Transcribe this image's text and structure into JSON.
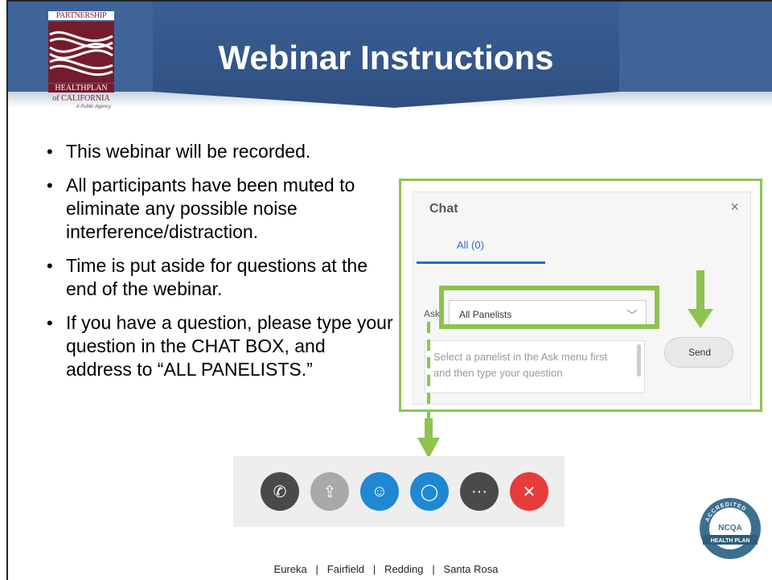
{
  "title": "Webinar Instructions",
  "logo": {
    "line_top": "PARTNERSHIP",
    "line_mid": "HEALTHPLAN",
    "line_bottom": "of CALIFORNIA",
    "tagline": "A Public Agency"
  },
  "bullets": [
    "This webinar will be recorded.",
    "All participants have been muted to eliminate any possible noise interference/distraction.",
    "Time is put aside for questions at the end of the webinar.",
    "If you have a question, please type your question in the CHAT BOX, and address to “ALL PANELISTS.”"
  ],
  "chat": {
    "title": "Chat",
    "close_glyph": "×",
    "tab_label": "All (0)",
    "ask_label": "Ask:",
    "ask_selected": "All Panelists",
    "message_placeholder": "Select a panelist in the Ask menu first and then type your question",
    "send_label": "Send"
  },
  "toolbar": {
    "buttons": [
      {
        "name": "phone-button",
        "icon": "phone-icon",
        "glyph": "✆",
        "color": "#4a4a4a"
      },
      {
        "name": "share-button",
        "icon": "share-icon",
        "glyph": "⇪",
        "color": "#a9a9a9"
      },
      {
        "name": "participants-button",
        "icon": "participants-icon",
        "glyph": "☺",
        "color": "#1e88d2"
      },
      {
        "name": "chat-button",
        "icon": "chat-bubble-icon",
        "glyph": "◯",
        "color": "#1e88d2"
      },
      {
        "name": "more-button",
        "icon": "more-icon",
        "glyph": "···",
        "color": "#4a4a4a"
      },
      {
        "name": "leave-button",
        "icon": "close-icon",
        "glyph": "✕",
        "color": "#e83b3b"
      }
    ]
  },
  "ncqa": {
    "arc_text": "ACCREDITED",
    "badge_text": "NCQA",
    "band_text": "HEALTH PLAN"
  },
  "footer": "Eureka   |   Fairfield   |   Redding   |   Santa Rosa",
  "colors": {
    "header_blue": "#3f6498",
    "highlight_green": "#8dc44e",
    "logo_maroon": "#741c2c"
  }
}
